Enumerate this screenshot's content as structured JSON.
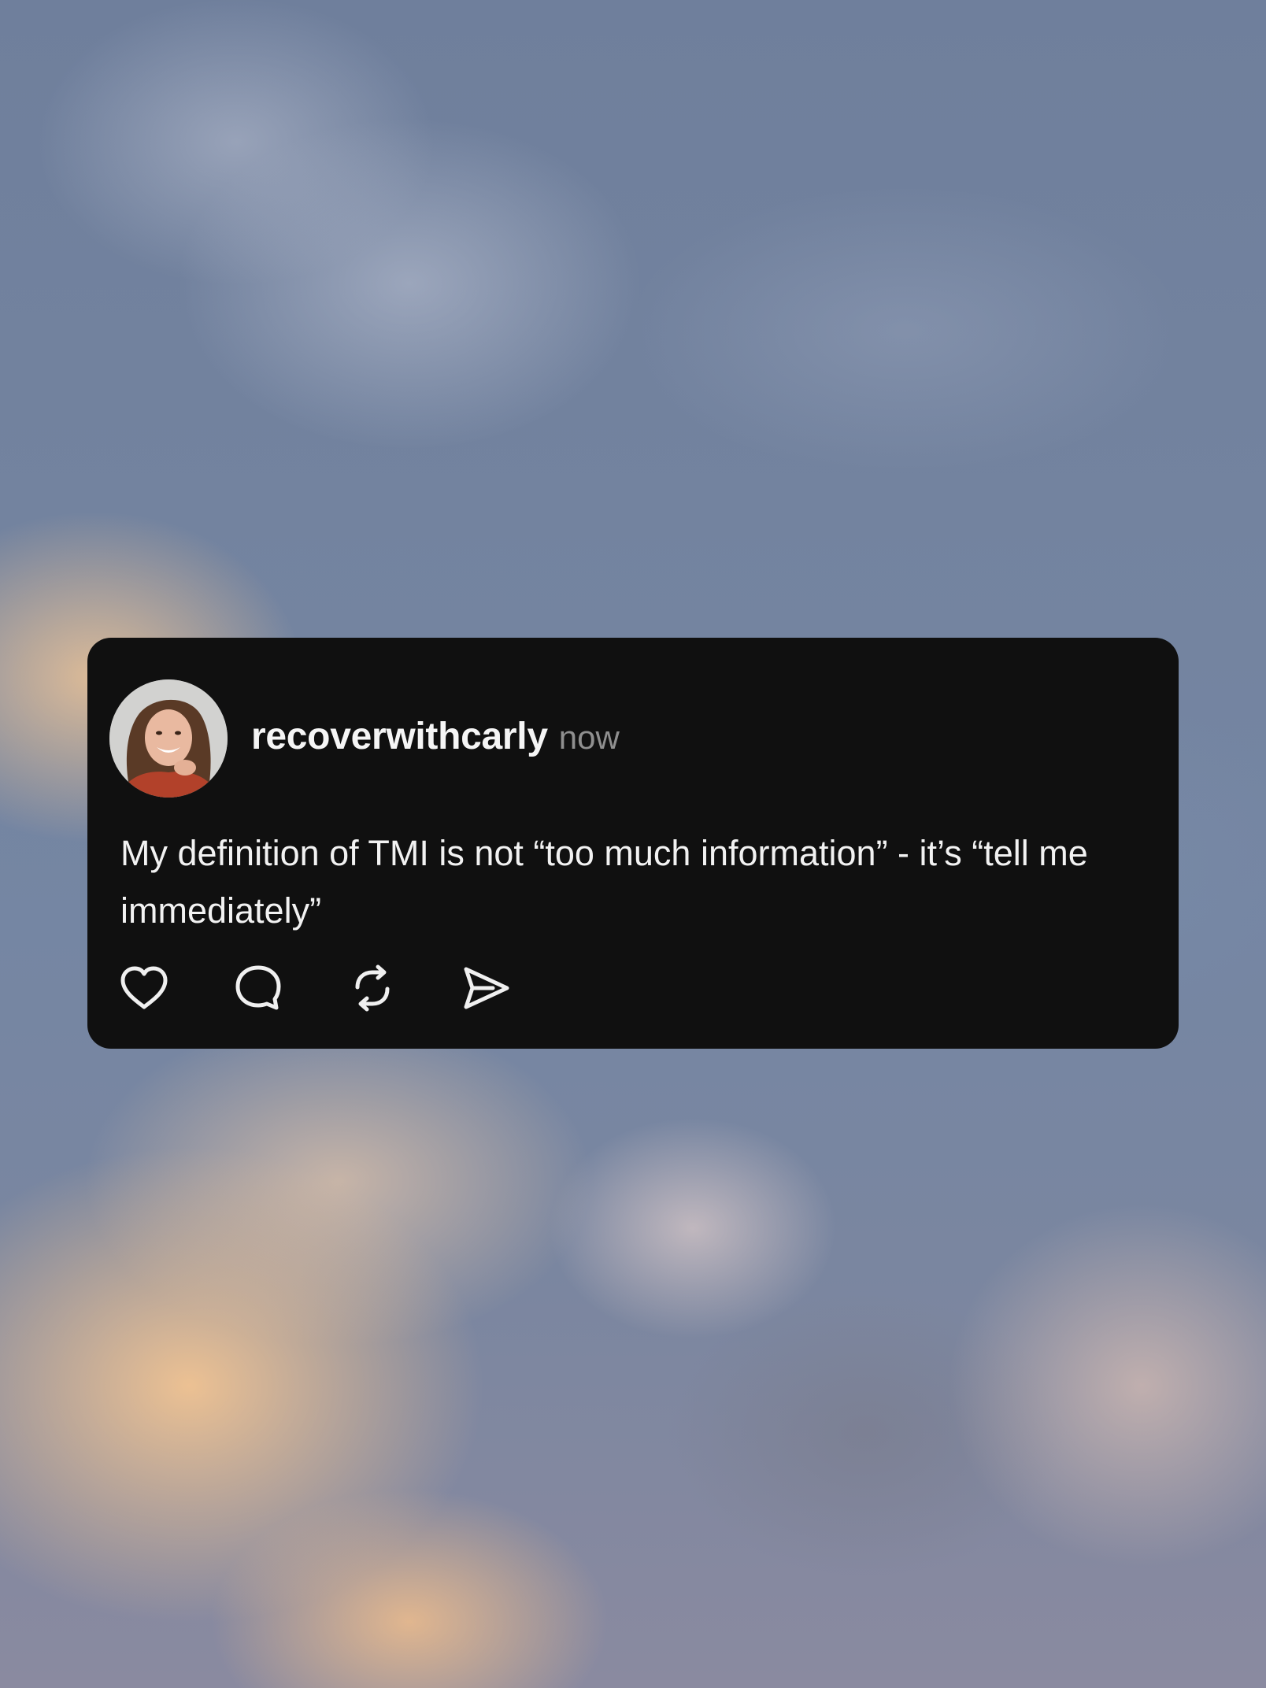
{
  "post": {
    "username": "recoverwithcarly",
    "timestamp": "now",
    "text": "My definition of TMI is not “too much information” - it’s “tell me immediately”",
    "avatar_alt": "profile photo of recoverwithcarly"
  },
  "actions": [
    {
      "name": "like",
      "icon": "heart-icon"
    },
    {
      "name": "comment",
      "icon": "comment-icon"
    },
    {
      "name": "repost",
      "icon": "repost-icon"
    },
    {
      "name": "share",
      "icon": "send-icon"
    }
  ],
  "colors": {
    "card_background": "#101010",
    "username": "#f5f5f5",
    "timestamp": "#8f8f8f",
    "text": "#f2f2f2",
    "icon": "#f0f0f0"
  }
}
